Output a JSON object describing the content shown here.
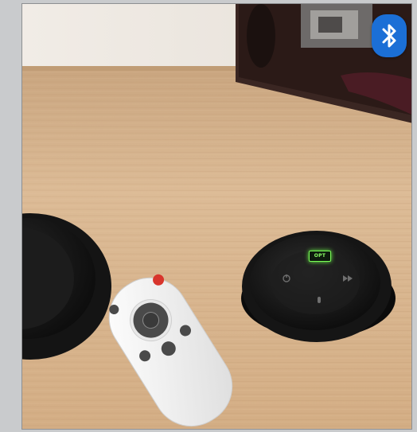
{
  "scene": {
    "description_icons": [
      "bluetooth-icon",
      "power-icon",
      "skip-icon",
      "microphone-icon",
      "volume-icon"
    ],
    "colors": {
      "desk": "#d7b690",
      "hub": "#1a1a1a",
      "remote": "#f1f1f1",
      "remote_red_button": "#d8352c",
      "bluetooth_badge": "#1b6fd6",
      "led": "#7bff58"
    }
  },
  "hub": {
    "mode_led_label": "OPT"
  }
}
